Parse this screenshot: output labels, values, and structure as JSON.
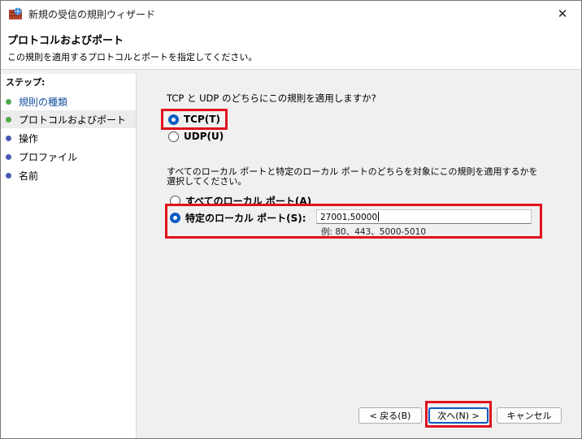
{
  "window": {
    "title": "新規の受信の規則ウィザード",
    "close": "✕"
  },
  "header": {
    "title": "プロトコルおよびポート",
    "description": "この規則を適用するプロトコルとポートを指定してください。"
  },
  "steps": {
    "header": "ステップ:",
    "items": [
      {
        "label": "規則の種類",
        "state": "done"
      },
      {
        "label": "プロトコルおよびポート",
        "state": "current"
      },
      {
        "label": "操作",
        "state": "todo"
      },
      {
        "label": "プロファイル",
        "state": "todo"
      },
      {
        "label": "名前",
        "state": "todo"
      }
    ]
  },
  "protocol": {
    "question": "TCP と UDP のどちらにこの規則を適用しますか?",
    "tcp_label": "TCP(T)",
    "udp_label": "UDP(U)",
    "selected": "TCP(T)"
  },
  "ports": {
    "description": "すべてのローカル ポートと特定のローカル ポートのどちらを対象にこの規則を適用するかを選択してください。",
    "all_label": "すべてのローカル ポート(A)",
    "specific_label": "特定のローカル ポート(S):",
    "specific_value": "27001,50000",
    "example": "例: 80、443、5000-5010",
    "selected": "特定のローカル ポート(S):"
  },
  "buttons": {
    "back": "< 戻る(B)",
    "next": "次へ(N) >",
    "cancel": "キャンセル"
  },
  "colors": {
    "highlight": "#e0121c",
    "radio_selected": "#0c5cc4"
  }
}
